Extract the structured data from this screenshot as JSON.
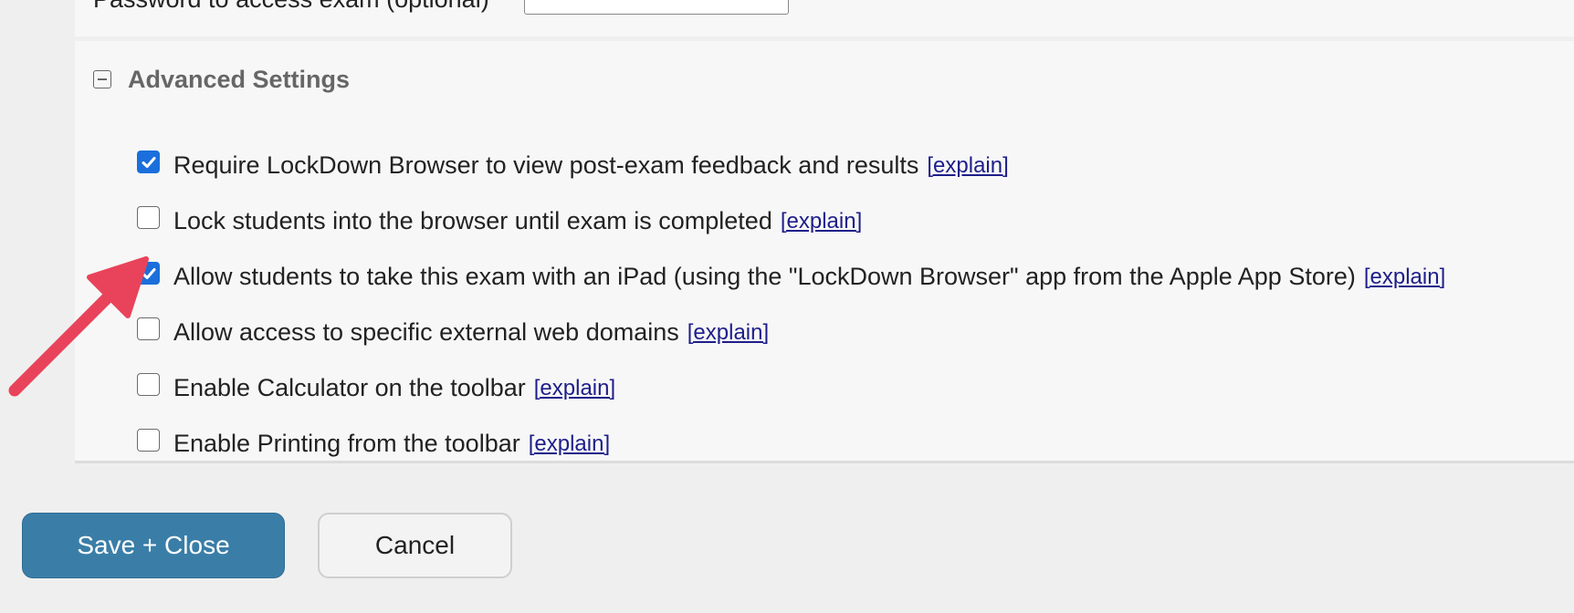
{
  "top": {
    "password_label": "Password to access exam (optional)"
  },
  "advanced": {
    "title": "Advanced Settings",
    "explain_label": "[explain]",
    "options": [
      {
        "label": "Require LockDown Browser to view post-exam feedback and results",
        "checked": true
      },
      {
        "label": "Lock students into the browser until exam is completed",
        "checked": false
      },
      {
        "label": "Allow students to take this exam with an iPad (using the \"LockDown Browser\" app from the Apple App Store)",
        "checked": true
      },
      {
        "label": "Allow access to specific external web domains",
        "checked": false
      },
      {
        "label": "Enable Calculator on the toolbar",
        "checked": false
      },
      {
        "label": "Enable Printing from the toolbar",
        "checked": false
      }
    ]
  },
  "buttons": {
    "save_close": "Save + Close",
    "cancel": "Cancel"
  },
  "colors": {
    "checkbox_checked": "#1a6fdc",
    "save_button": "#3a7ea8",
    "explain_link": "#1e1e8a",
    "annotation_arrow": "#e8435a"
  },
  "icons": {
    "collapse": "collapse-minus-icon",
    "check": "checkmark-icon",
    "annotation": "annotation-arrow-icon"
  }
}
